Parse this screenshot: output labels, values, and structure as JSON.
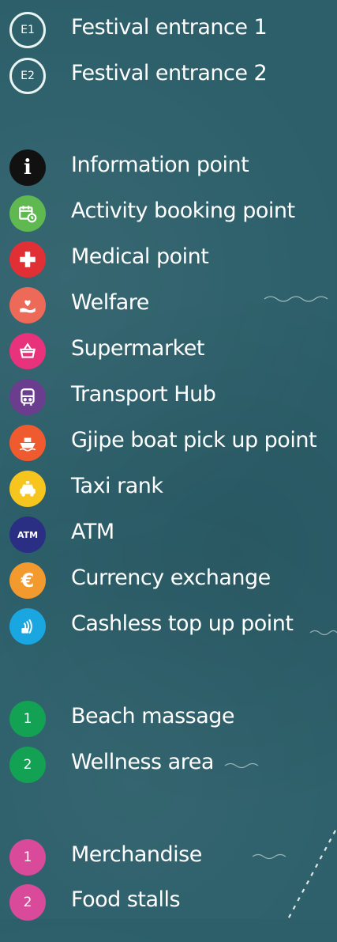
{
  "entrances": [
    {
      "code": "E1",
      "label": "Festival entrance 1"
    },
    {
      "code": "E2",
      "label": "Festival entrance 2"
    }
  ],
  "facilities": [
    {
      "icon": "info-icon",
      "label": "Information point",
      "color": "#111111"
    },
    {
      "icon": "calendar-booking-icon",
      "label": "Activity booking point",
      "color": "#5fb850"
    },
    {
      "icon": "medical-cross-icon",
      "label": "Medical point",
      "color": "#e03036"
    },
    {
      "icon": "heart-hand-icon",
      "label": "Welfare",
      "color": "#ec6a57"
    },
    {
      "icon": "basket-icon",
      "label": "Supermarket",
      "color": "#e8327c"
    },
    {
      "icon": "bus-icon",
      "label": "Transport Hub",
      "color": "#6a3d8f"
    },
    {
      "icon": "boat-icon",
      "label": "Gjipe boat pick up point",
      "color": "#ef5a2f"
    },
    {
      "icon": "taxi-icon",
      "label": "Taxi rank",
      "color": "#f6c51e"
    },
    {
      "icon": "atm-icon",
      "label": "ATM",
      "color": "#2a2f83",
      "text": "ATM"
    },
    {
      "icon": "euro-icon",
      "label": "Currency exchange",
      "color": "#f29a2e",
      "text": "€"
    },
    {
      "icon": "contactless-card-icon",
      "label": "Cashless top up point",
      "color": "#1aa6e0"
    }
  ],
  "wellness": [
    {
      "number": "1",
      "label": "Beach massage",
      "color": "#13a254"
    },
    {
      "number": "2",
      "label": "Wellness area",
      "color": "#13a254"
    }
  ],
  "shops": [
    {
      "number": "1",
      "label": "Merchandise",
      "color": "#d94a9a"
    },
    {
      "number": "2",
      "label": "Food stalls",
      "color": "#d94a9a"
    }
  ]
}
